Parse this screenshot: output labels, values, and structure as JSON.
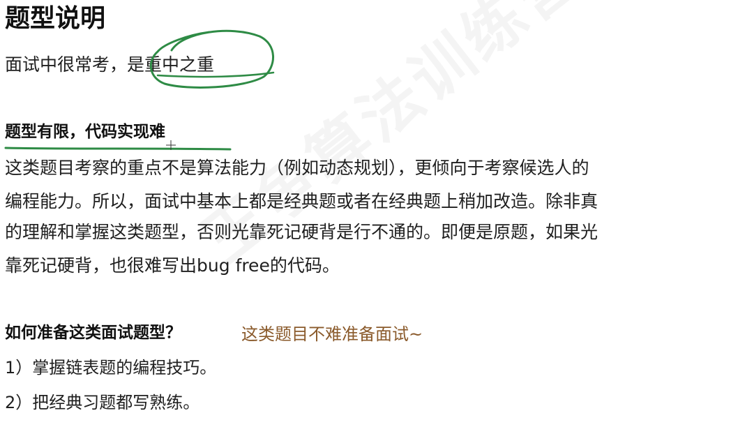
{
  "title": "题型说明",
  "intro": "面试中很常考，是重中之重",
  "section1": {
    "heading": "题型有限，代码实现难",
    "lines": [
      "这类题目考察的重点不是算法能力（例如动态规划），更倾向于考察候选人的",
      "编程能力。所以，面试中基本上都是经典题或者在经典题上稍加改造。除非真",
      "的理解和掌握这类题型，否则光靠死记硬背是行不通的。即便是原题，如果光",
      "靠死记硬背，也很难写出bug free的代码。"
    ]
  },
  "section2": {
    "heading": "如何准备这类面试题型？",
    "note": "这类题目不难准备面试~",
    "steps": [
      "1）掌握链表题的编程技巧。",
      "2）把经典习题都写熟练。"
    ]
  },
  "watermark": "王争算法训练营",
  "colors": {
    "annotation_green": "#2e8b45",
    "note_brown": "#8a5a2b",
    "text": "#1f1f1f"
  }
}
